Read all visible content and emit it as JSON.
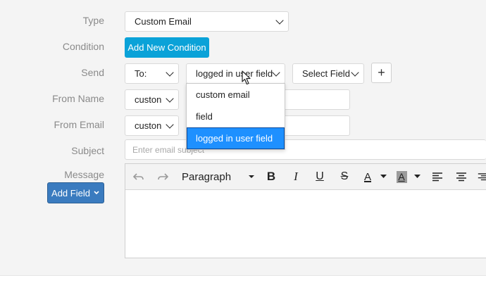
{
  "labels": {
    "type": "Type",
    "condition": "Condition",
    "send": "Send",
    "from_name": "From Name",
    "from_email": "From Email",
    "subject": "Subject",
    "message": "Message"
  },
  "type_select": {
    "value": "Custom Email"
  },
  "add_condition_label": "Add New Condition",
  "send_row": {
    "to_value": "To:",
    "recipient_value": "logged in user field",
    "field_value": "Select Field",
    "plus_label": "+"
  },
  "recipient_options": [
    {
      "label": "custom email",
      "selected": false
    },
    {
      "label": "field",
      "selected": false
    },
    {
      "label": "logged in user field",
      "selected": true
    }
  ],
  "from_name": {
    "select_value": "custon"
  },
  "from_email": {
    "select_value": "custon"
  },
  "subject": {
    "placeholder": "Enter email subject"
  },
  "editor": {
    "block_format": "Paragraph",
    "tools": {
      "undo": "undo-icon",
      "redo": "redo-icon",
      "bold": "B",
      "italic": "I",
      "underline": "U",
      "strike": "S",
      "text_color": "A",
      "bg_color": "A"
    }
  },
  "add_field_label": "Add Field",
  "colors": {
    "accent": "#0aa2d8",
    "add_field": "#3a7bbf",
    "selected_option": "#1e90ff"
  }
}
